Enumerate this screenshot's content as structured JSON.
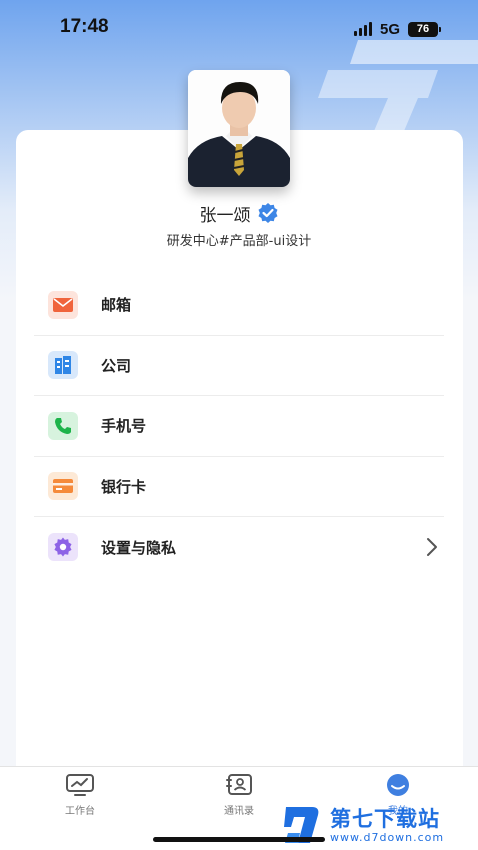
{
  "status_bar": {
    "time": "17:48",
    "network": "5G",
    "battery": "76"
  },
  "profile": {
    "name": "张一颂",
    "department": "研发中心#产品部-ui设计",
    "avatar_icon": "person-photo",
    "verified_icon": "verified-badge-icon"
  },
  "menu": {
    "items": [
      {
        "label": "邮箱",
        "icon": "mail-icon",
        "color": "#f0643c"
      },
      {
        "label": "公司",
        "icon": "building-icon",
        "color": "#2f86e6"
      },
      {
        "label": "手机号",
        "icon": "phone-icon",
        "color": "#1db44a"
      },
      {
        "label": "银行卡",
        "icon": "bank-card-icon",
        "color": "#f58a3a"
      },
      {
        "label": "设置与隐私",
        "icon": "gear-icon",
        "color": "#8d63e6"
      }
    ]
  },
  "tabbar": {
    "tabs": [
      {
        "label": "工作台",
        "icon": "monitor-chart-icon"
      },
      {
        "label": "通讯录",
        "icon": "contacts-icon"
      },
      {
        "label": "我的",
        "icon": "smile-face-icon",
        "active": true
      }
    ]
  },
  "watermark": {
    "title": "第七下载站",
    "url": "www.d7down.com"
  },
  "colors": {
    "accent": "#3f7fe0",
    "hero_top": "#6fa4ee",
    "card": "#ffffff"
  }
}
